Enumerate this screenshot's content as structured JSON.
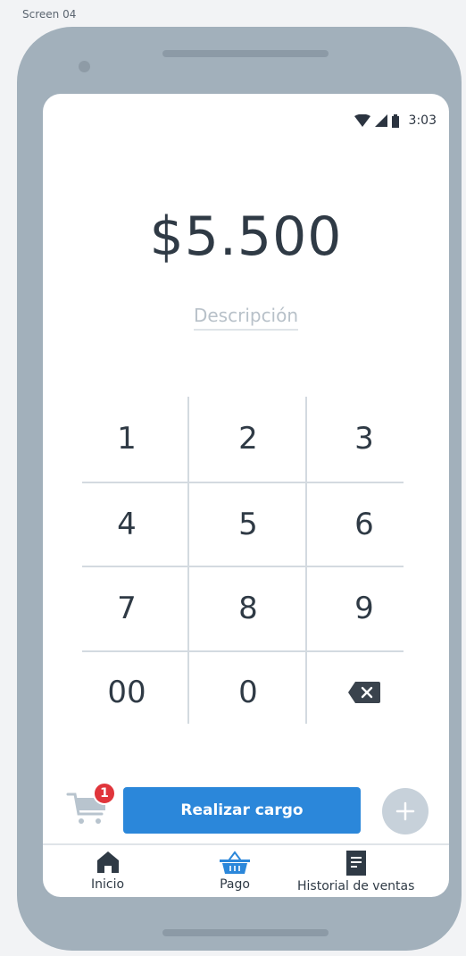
{
  "screen_label": "Screen 04",
  "status_bar": {
    "time": "3:03",
    "icons": [
      "wifi-icon",
      "signal-icon",
      "battery-icon"
    ]
  },
  "amount": "$5.500",
  "description_placeholder": "Descripción",
  "keypad": {
    "keys": [
      "1",
      "2",
      "3",
      "4",
      "5",
      "6",
      "7",
      "8",
      "9",
      "00",
      "0"
    ],
    "backspace_icon": "backspace-icon"
  },
  "cart": {
    "badge_count": "1",
    "icon": "cart-icon"
  },
  "charge_button": {
    "label": "Realizar cargo"
  },
  "add_button": {
    "icon": "plus-icon"
  },
  "nav": {
    "items": [
      {
        "label": "Inicio",
        "icon": "home-icon"
      },
      {
        "label": "Pago",
        "icon": "basket-icon"
      },
      {
        "label": "Historial de ventas",
        "icon": "document-icon"
      }
    ]
  },
  "colors": {
    "primary": "#2b87da",
    "badge": "#e0353b",
    "device": "#a2b0bb",
    "text_dark": "#2f3a45",
    "muted": "#b8c1c9"
  }
}
